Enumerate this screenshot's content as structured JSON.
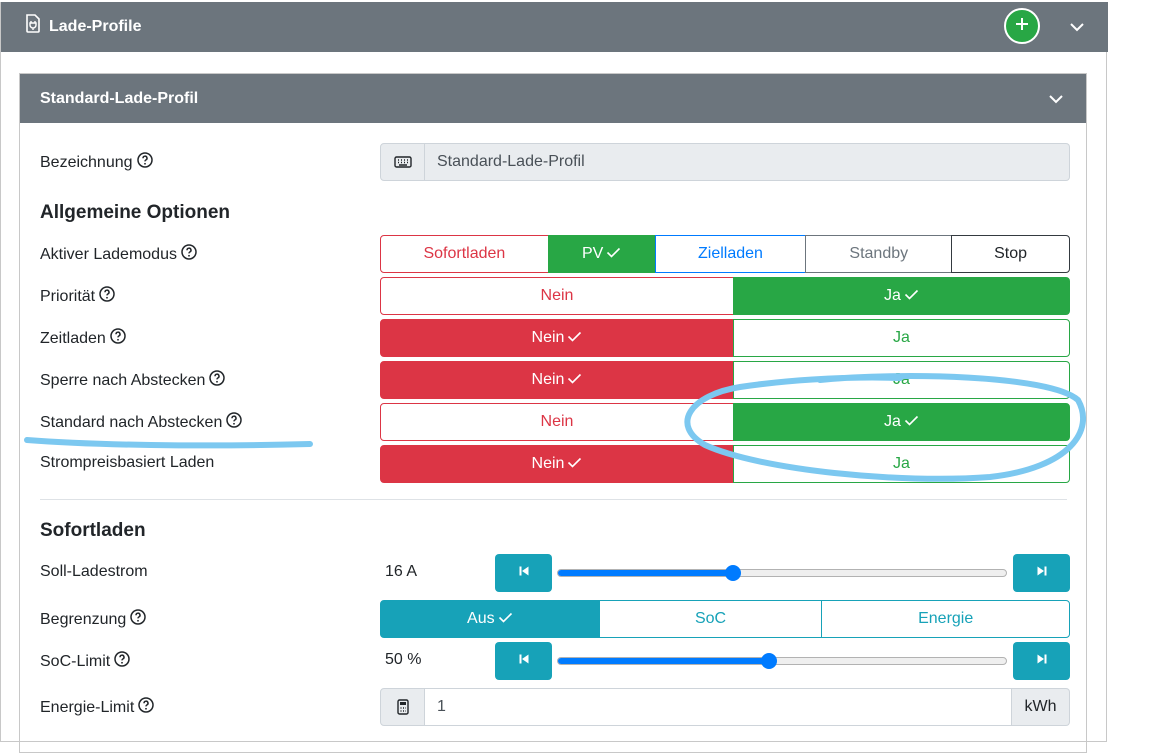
{
  "outer": {
    "title": "Lade-Profile"
  },
  "profile": {
    "title": "Standard-Lade-Profil"
  },
  "bezeichnung": {
    "label": "Bezeichnung",
    "value": "Standard-Lade-Profil"
  },
  "allgemein": {
    "title": "Allgemeine Optionen",
    "lademodus": {
      "label": "Aktiver Lademodus",
      "options": [
        "Sofortladen",
        "PV",
        "Zielladen",
        "Standby",
        "Stop"
      ],
      "selected": "PV"
    },
    "prioritaet": {
      "label": "Priorität",
      "nein": "Nein",
      "ja": "Ja",
      "selected": "Ja"
    },
    "zeitladen": {
      "label": "Zeitladen",
      "nein": "Nein",
      "ja": "Ja",
      "selected": "Nein"
    },
    "sperre": {
      "label": "Sperre nach Abstecken",
      "nein": "Nein",
      "ja": "Ja",
      "selected": "Nein"
    },
    "standard": {
      "label": "Standard nach Abstecken",
      "nein": "Nein",
      "ja": "Ja",
      "selected": "Ja"
    },
    "strompreis": {
      "label": "Strompreisbasiert Laden",
      "nein": "Nein",
      "ja": "Ja",
      "selected": "Nein"
    }
  },
  "sofortladen": {
    "title": "Sofortladen",
    "soll": {
      "label": "Soll-Ladestrom",
      "value": "16 A",
      "level": 0.39
    },
    "begrenzung": {
      "label": "Begrenzung",
      "options": [
        "Aus",
        "SoC",
        "Energie"
      ],
      "selected": "Aus"
    },
    "soc": {
      "label": "SoC-Limit",
      "value": "50 %",
      "level": 0.47
    },
    "energie": {
      "label": "Energie-Limit",
      "value": "1",
      "unit": "kWh"
    }
  },
  "colors": {
    "header": "#6c757d",
    "success": "#28a745",
    "danger": "#dc3545",
    "info": "#17a2b8",
    "primary": "#007bff",
    "annotation": "#7cc8f0"
  },
  "icons": {
    "header": "document-plug-icon",
    "add": "plus-circle-icon",
    "collapse": "chevron-down-icon",
    "help": "question-circle-icon",
    "keyboard": "keyboard-icon",
    "calculator": "calculator-icon",
    "step_back": "skip-start-icon",
    "step_forward": "skip-end-icon",
    "check": "check-icon"
  }
}
